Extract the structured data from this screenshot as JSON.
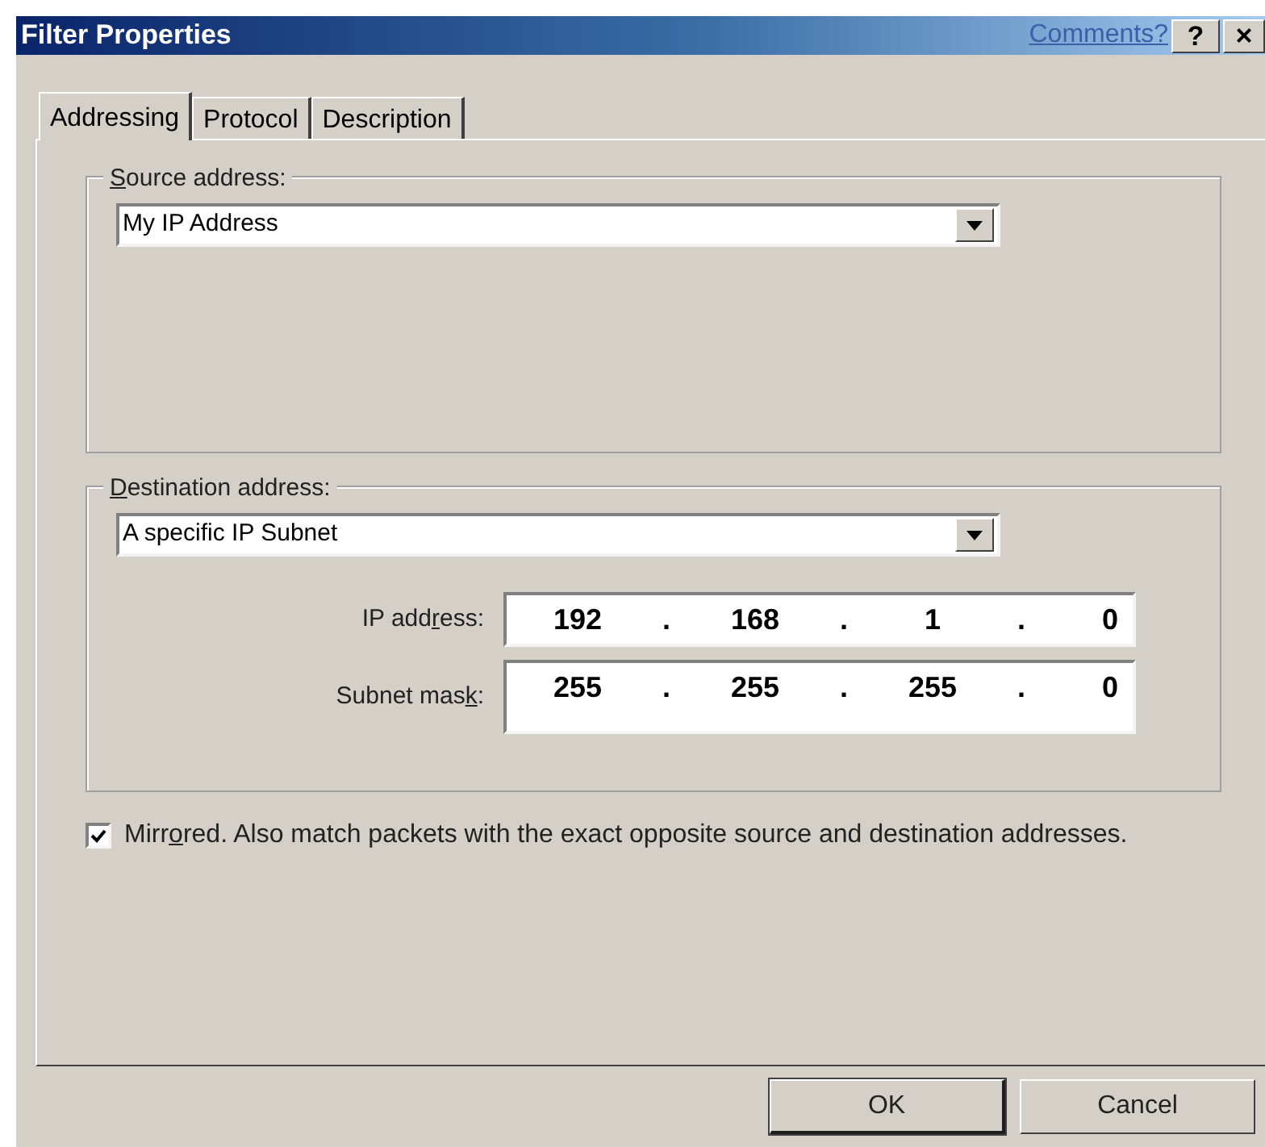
{
  "window": {
    "title": "Filter Properties",
    "comments_link": "Comments?",
    "help_button": "?",
    "close_button": "×"
  },
  "tabs": [
    {
      "label": "Addressing",
      "selected": true
    },
    {
      "label": "Protocol",
      "selected": false
    },
    {
      "label": "Description",
      "selected": false
    }
  ],
  "source": {
    "label": {
      "key": "S",
      "after": "ource address:"
    },
    "dropdown": {
      "value": "My IP Address"
    }
  },
  "destination": {
    "label": {
      "key": "D",
      "after": "estination address:"
    },
    "dropdown": {
      "value": "A specific IP Subnet"
    },
    "fields": [
      {
        "label": {
          "before": "IP add",
          "key": "r",
          "after": "ess:"
        },
        "octets": [
          "192",
          "168",
          "1",
          "0"
        ],
        "separators": [
          ".",
          ".",
          "."
        ]
      },
      {
        "label": {
          "before": "Subnet mas",
          "key": "k",
          "after": ":"
        },
        "octets": [
          "255",
          "255",
          "255",
          "0"
        ],
        "separators": [
          ".",
          ".",
          "."
        ]
      }
    ]
  },
  "mirrored": {
    "checked": true,
    "label": {
      "before": "Mirr",
      "key": "o",
      "after": "red. Also match packets with the exact opposite source and destination addresses."
    }
  },
  "buttons": [
    {
      "label": "OK",
      "default": true
    },
    {
      "label": "Cancel",
      "default": false
    }
  ]
}
